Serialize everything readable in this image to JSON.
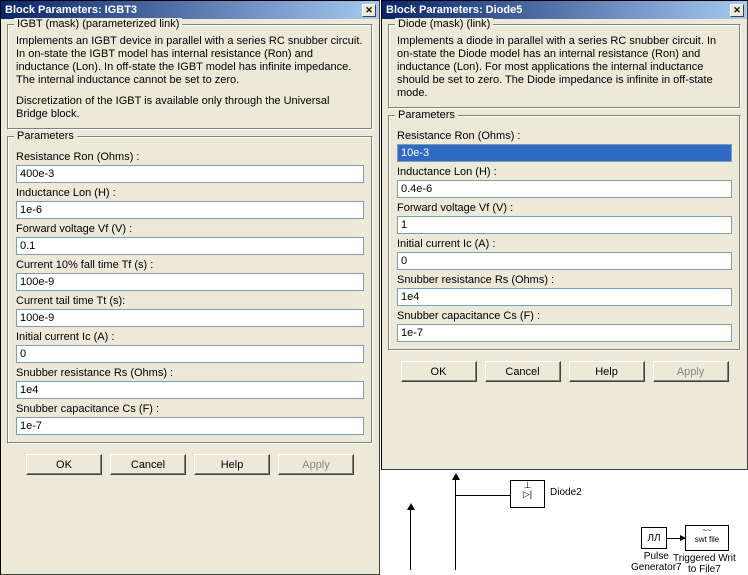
{
  "dialog_left": {
    "title": "Block Parameters: IGBT3",
    "desc_title": "IGBT (mask) (parameterized link)",
    "desc1": "Implements an IGBT device  in parallel with a series RC snubber circuit. In on-state the IGBT model has internal resistance (Ron) and inductance (Lon). In off-state the IGBT model has infinite impedance. The internal inductance cannot be set to zero.",
    "desc2": "Discretization of the IGBT is available only through the Universal Bridge block.",
    "params_legend": "Parameters",
    "params": [
      {
        "label": "Resistance Ron (Ohms) :",
        "value": "400e-3"
      },
      {
        "label": "Inductance Lon (H) :",
        "value": "1e-6"
      },
      {
        "label": "Forward voltage Vf (V) :",
        "value": "0.1"
      },
      {
        "label": "Current 10% fall time Tf (s) :",
        "value": "100e-9"
      },
      {
        "label": "Current tail time Tt (s):",
        "value": "100e-9"
      },
      {
        "label": "Initial current Ic (A) :",
        "value": "0"
      },
      {
        "label": "Snubber resistance Rs (Ohms) :",
        "value": "1e4"
      },
      {
        "label": "Snubber capacitance Cs (F) :",
        "value": "1e-7"
      }
    ]
  },
  "dialog_right": {
    "title": "Block Parameters: Diode5",
    "desc_title": "Diode (mask) (link)",
    "desc1": "Implements a diode in parallel with a series RC snubber circuit. In on-state the Diode model has an internal resistance (Ron) and inductance (Lon). For most applications the internal inductance should be set to zero. The Diode impedance is infinite in off-state mode.",
    "params_legend": "Parameters",
    "params": [
      {
        "label": "Resistance Ron (Ohms) :",
        "value": "10e-3"
      },
      {
        "label": "Inductance Lon (H) :",
        "value": "0.4e-6"
      },
      {
        "label": "Forward voltage Vf (V) :",
        "value": "1"
      },
      {
        "label": "Initial current Ic (A) :",
        "value": "0"
      },
      {
        "label": "Snubber resistance Rs (Ohms) :",
        "value": "1e4"
      },
      {
        "label": "Snubber capacitance Cs (F) :",
        "value": "1e-7"
      }
    ]
  },
  "buttons": {
    "ok": "OK",
    "cancel": "Cancel",
    "help": "Help",
    "apply": "Apply"
  },
  "bg": {
    "diode2": "Diode2",
    "pulse": "Pulse\nGenerator7",
    "trig": "Triggered Writ\nto File7",
    "swt": "swt file"
  }
}
